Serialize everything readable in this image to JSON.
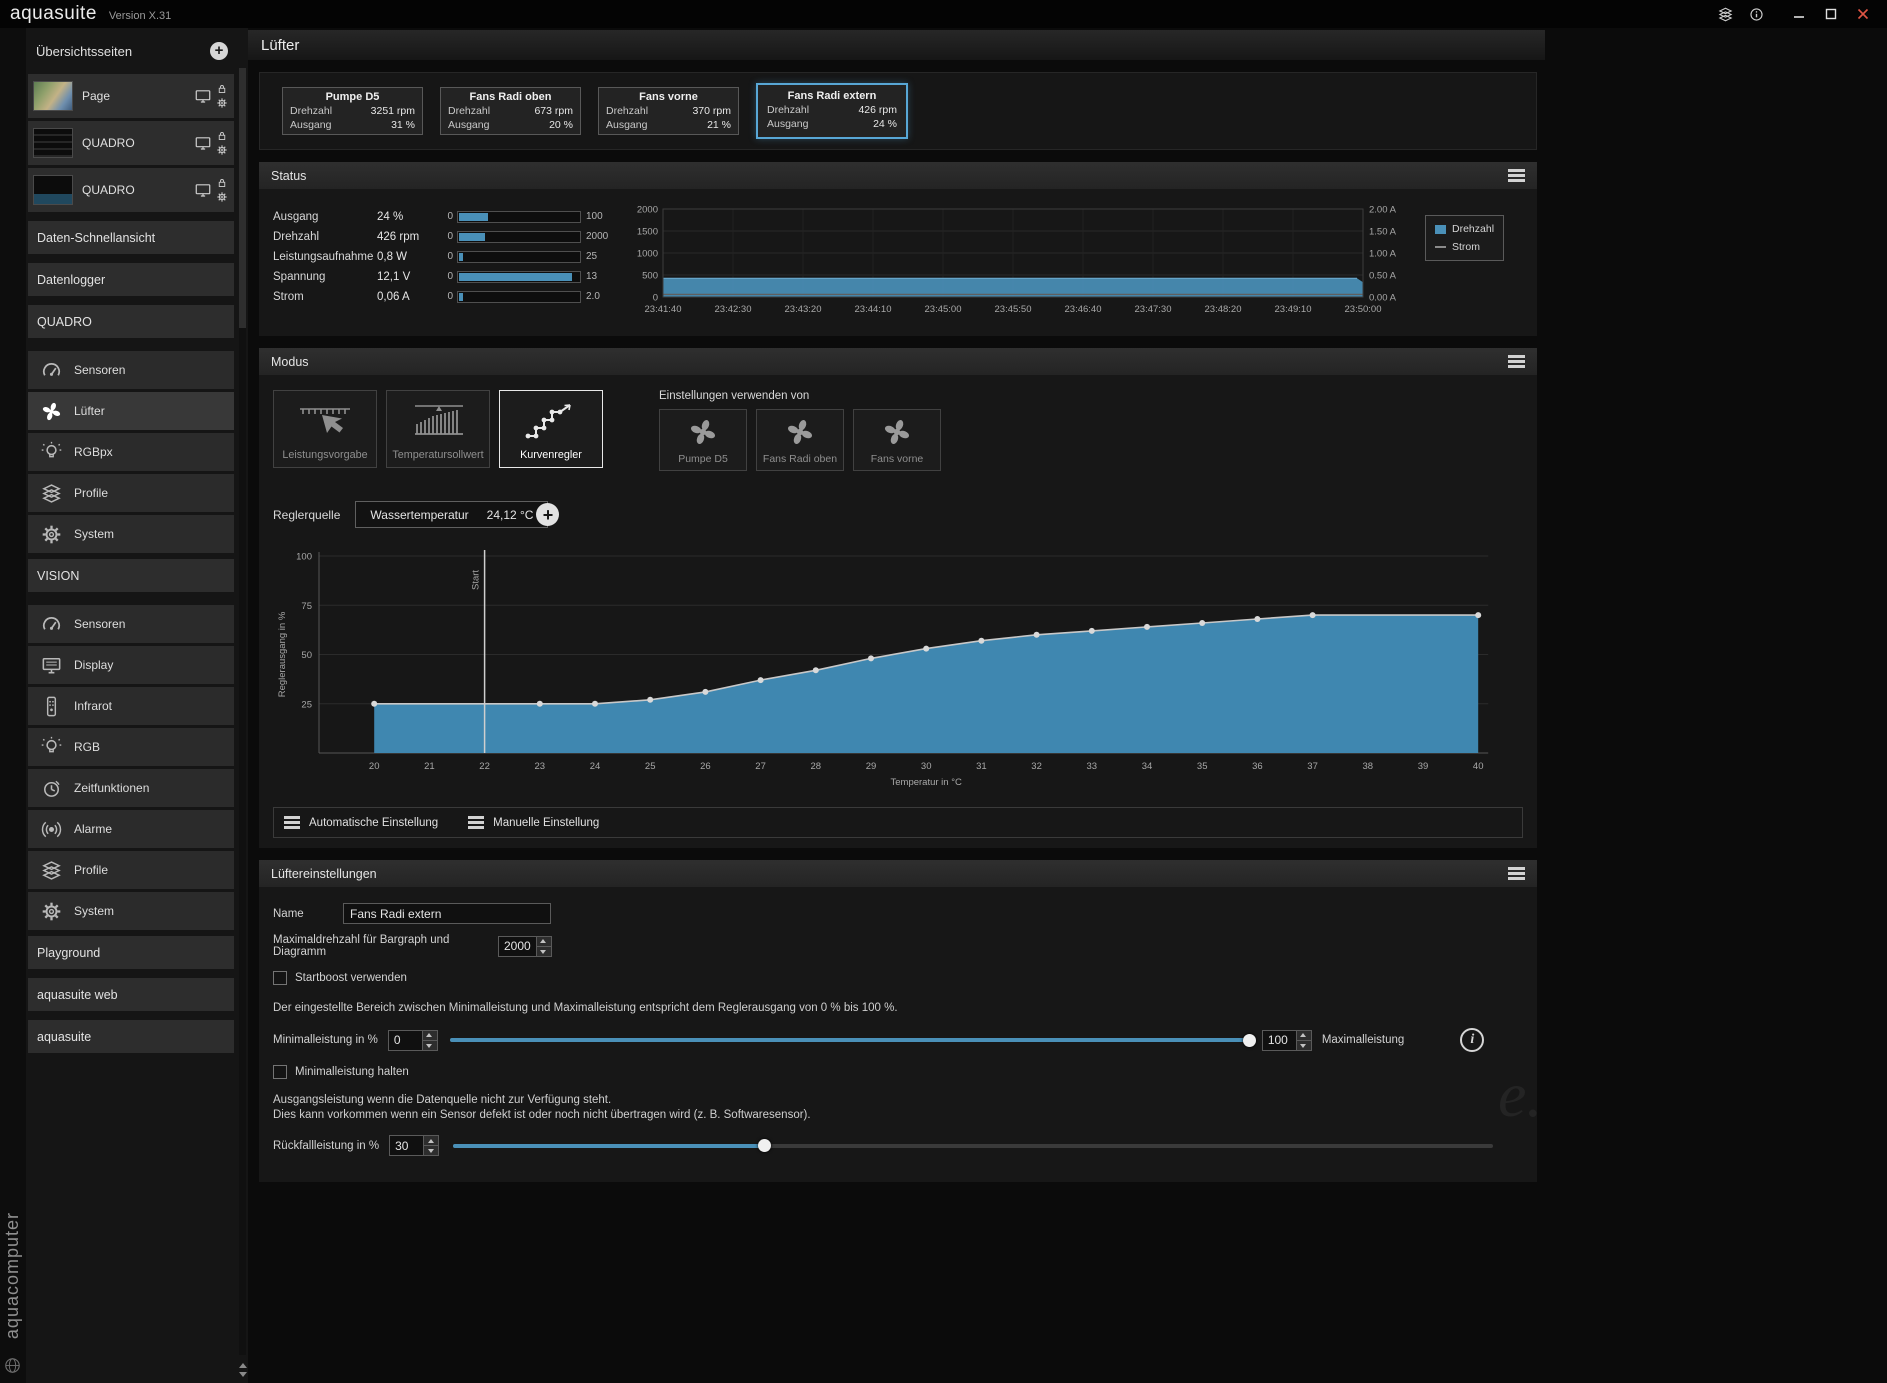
{
  "titlebar": {
    "app": "aquasuite",
    "version": "Version X.31"
  },
  "icons": {
    "plus": "+",
    "info": "i"
  },
  "watermark": "e.",
  "colors": {
    "accent": "#4a90b8",
    "selected_border": "#58a7d6"
  },
  "sidebar": {
    "brand_vertical": "aquacomputer",
    "overview_header": "Übersichtsseiten",
    "overview_pages": [
      {
        "label": "Page"
      },
      {
        "label": "QUADRO"
      },
      {
        "label": "QUADRO"
      }
    ],
    "quick_items": [
      "Daten-Schnellansicht",
      "Datenlogger"
    ],
    "groups": [
      {
        "label": "QUADRO",
        "items": [
          {
            "label": "Sensoren",
            "icon": "gauge-icon"
          },
          {
            "label": "Lüfter",
            "icon": "fan-icon",
            "selected": true
          },
          {
            "label": "RGBpx",
            "icon": "bulb-icon"
          },
          {
            "label": "Profile",
            "icon": "layers-icon"
          },
          {
            "label": "System",
            "icon": "gear-icon"
          }
        ]
      },
      {
        "label": "VISION",
        "items": [
          {
            "label": "Sensoren",
            "icon": "gauge-icon"
          },
          {
            "label": "Display",
            "icon": "display-icon"
          },
          {
            "label": "Infrarot",
            "icon": "remote-icon"
          },
          {
            "label": "RGB",
            "icon": "bulb-icon"
          },
          {
            "label": "Zeitfunktionen",
            "icon": "clock-icon"
          },
          {
            "label": "Alarme",
            "icon": "alarm-icon"
          },
          {
            "label": "Profile",
            "icon": "layers-icon"
          },
          {
            "label": "System",
            "icon": "gear-icon"
          }
        ]
      }
    ],
    "bottom_items": [
      "Playground",
      "aquasuite web",
      "aquasuite"
    ]
  },
  "page": {
    "title": "Lüfter"
  },
  "cards": {
    "drehzahl_label": "Drehzahl",
    "ausgang_label": "Ausgang",
    "items": [
      {
        "name": "Pumpe D5",
        "drehzahl": "3251 rpm",
        "ausgang": "31 %",
        "selected": false
      },
      {
        "name": "Fans Radi oben",
        "drehzahl": "673 rpm",
        "ausgang": "20 %",
        "selected": false
      },
      {
        "name": "Fans vorne",
        "drehzahl": "370 rpm",
        "ausgang": "21 %",
        "selected": false
      },
      {
        "name": "Fans Radi extern",
        "drehzahl": "426 rpm",
        "ausgang": "24 %",
        "selected": true
      }
    ]
  },
  "status": {
    "title": "Status",
    "metrics": [
      {
        "label": "Ausgang",
        "value": "24 %",
        "min": "0",
        "max": "100",
        "fraction": 0.24
      },
      {
        "label": "Drehzahl",
        "value": "426 rpm",
        "min": "0",
        "max": "2000",
        "fraction": 0.213
      },
      {
        "label": "Leistungsaufnahme",
        "value": "0,8 W",
        "min": "0",
        "max": "25",
        "fraction": 0.032
      },
      {
        "label": "Spannung",
        "value": "12,1 V",
        "min": "0",
        "max": "13",
        "fraction": 0.93
      },
      {
        "label": "Strom",
        "value": "0,06 A",
        "min": "0",
        "max": "2.0",
        "fraction": 0.03
      }
    ]
  },
  "chart_data": [
    {
      "id": "status-history",
      "type": "area",
      "x_ticks": [
        "23:41:40",
        "23:42:30",
        "23:43:20",
        "23:44:10",
        "23:45:00",
        "23:45:50",
        "23:46:40",
        "23:47:30",
        "23:48:20",
        "23:49:10",
        "23:50:00"
      ],
      "y_left_ticks": [
        2000,
        1500,
        1000,
        500,
        0
      ],
      "y_left_max": 2000,
      "y_right_ticks": [
        "2.00 A",
        "1.50 A",
        "1.00 A",
        "0.50 A",
        "0.00 A"
      ],
      "legend_position": "right",
      "series": [
        {
          "name": "Drehzahl",
          "type": "area",
          "color": "#4a90b8",
          "value": 426,
          "axis_max": 2000
        },
        {
          "name": "Strom",
          "type": "line",
          "color": "#5f5f5f",
          "value": 0.06,
          "axis_max": 2.0
        }
      ]
    },
    {
      "id": "curve-controller",
      "type": "line",
      "xlabel": "Temperatur in °C",
      "ylabel": "Reglerausgang in %",
      "x_ticks": [
        20,
        21,
        22,
        23,
        24,
        25,
        26,
        27,
        28,
        29,
        30,
        31,
        32,
        33,
        34,
        35,
        36,
        37,
        38,
        39,
        40
      ],
      "y_ticks": [
        100,
        75,
        50,
        25
      ],
      "ylim": [
        0,
        100
      ],
      "start_marker": {
        "x": 22,
        "label": "Start"
      },
      "area_color": "#3f87b0",
      "line_color": "#c8c8c8",
      "points": [
        [
          20,
          25
        ],
        [
          23,
          25
        ],
        [
          24,
          25
        ],
        [
          25,
          27
        ],
        [
          26,
          31
        ],
        [
          27,
          37
        ],
        [
          28,
          42
        ],
        [
          29,
          48
        ],
        [
          30,
          53
        ],
        [
          31,
          57
        ],
        [
          32,
          60
        ],
        [
          33,
          62
        ],
        [
          34,
          64
        ],
        [
          35,
          66
        ],
        [
          36,
          68
        ],
        [
          37,
          70
        ],
        [
          40,
          70
        ]
      ]
    }
  ],
  "modus": {
    "title": "Modus",
    "modes": [
      {
        "label": "Leistungsvorgabe",
        "icon": "power-preset-icon",
        "selected": false
      },
      {
        "label": "Temperatursollwert",
        "icon": "temp-setpoint-icon",
        "selected": false
      },
      {
        "label": "Kurvenregler",
        "icon": "curve-icon",
        "selected": true
      }
    ],
    "use_settings_label": "Einstellungen verwenden von",
    "copy_sources": [
      {
        "label": "Pumpe D5"
      },
      {
        "label": "Fans Radi oben"
      },
      {
        "label": "Fans vorne"
      }
    ],
    "reglerquelle_label": "Reglerquelle",
    "source_name": "Wassertemperatur",
    "source_value": "24,12 °C",
    "auto_button": "Automatische Einstellung",
    "manual_button": "Manuelle Einstellung"
  },
  "settings": {
    "title": "Lüftereinstellungen",
    "name_label": "Name",
    "name_value": "Fans Radi extern",
    "maxrpm_label": "Maximaldrehzahl für Bargraph und Diagramm",
    "maxrpm_value": "2000",
    "startboost_label": "Startboost verwenden",
    "range_text": "Der eingestellte Bereich zwischen Minimalleistung und Maximalleistung entspricht dem Reglerausgang von 0 % bis 100 %.",
    "min_label": "Minimalleistung in %",
    "min_value": "0",
    "min_slider_fraction": 1.0,
    "max_value": "100",
    "max_label": "Maximalleistung",
    "hold_label": "Minimalleistung halten",
    "fallback_text_1": "Ausgangsleistung wenn die Datenquelle nicht zur Verfügung steht.",
    "fallback_text_2": "Dies kann vorkommen wenn ein Sensor defekt ist oder noch nicht übertragen wird (z. B. Softwaresensor).",
    "fallback_label": "Rückfallleistung in %",
    "fallback_value": "30",
    "fallback_fraction": 0.3
  }
}
